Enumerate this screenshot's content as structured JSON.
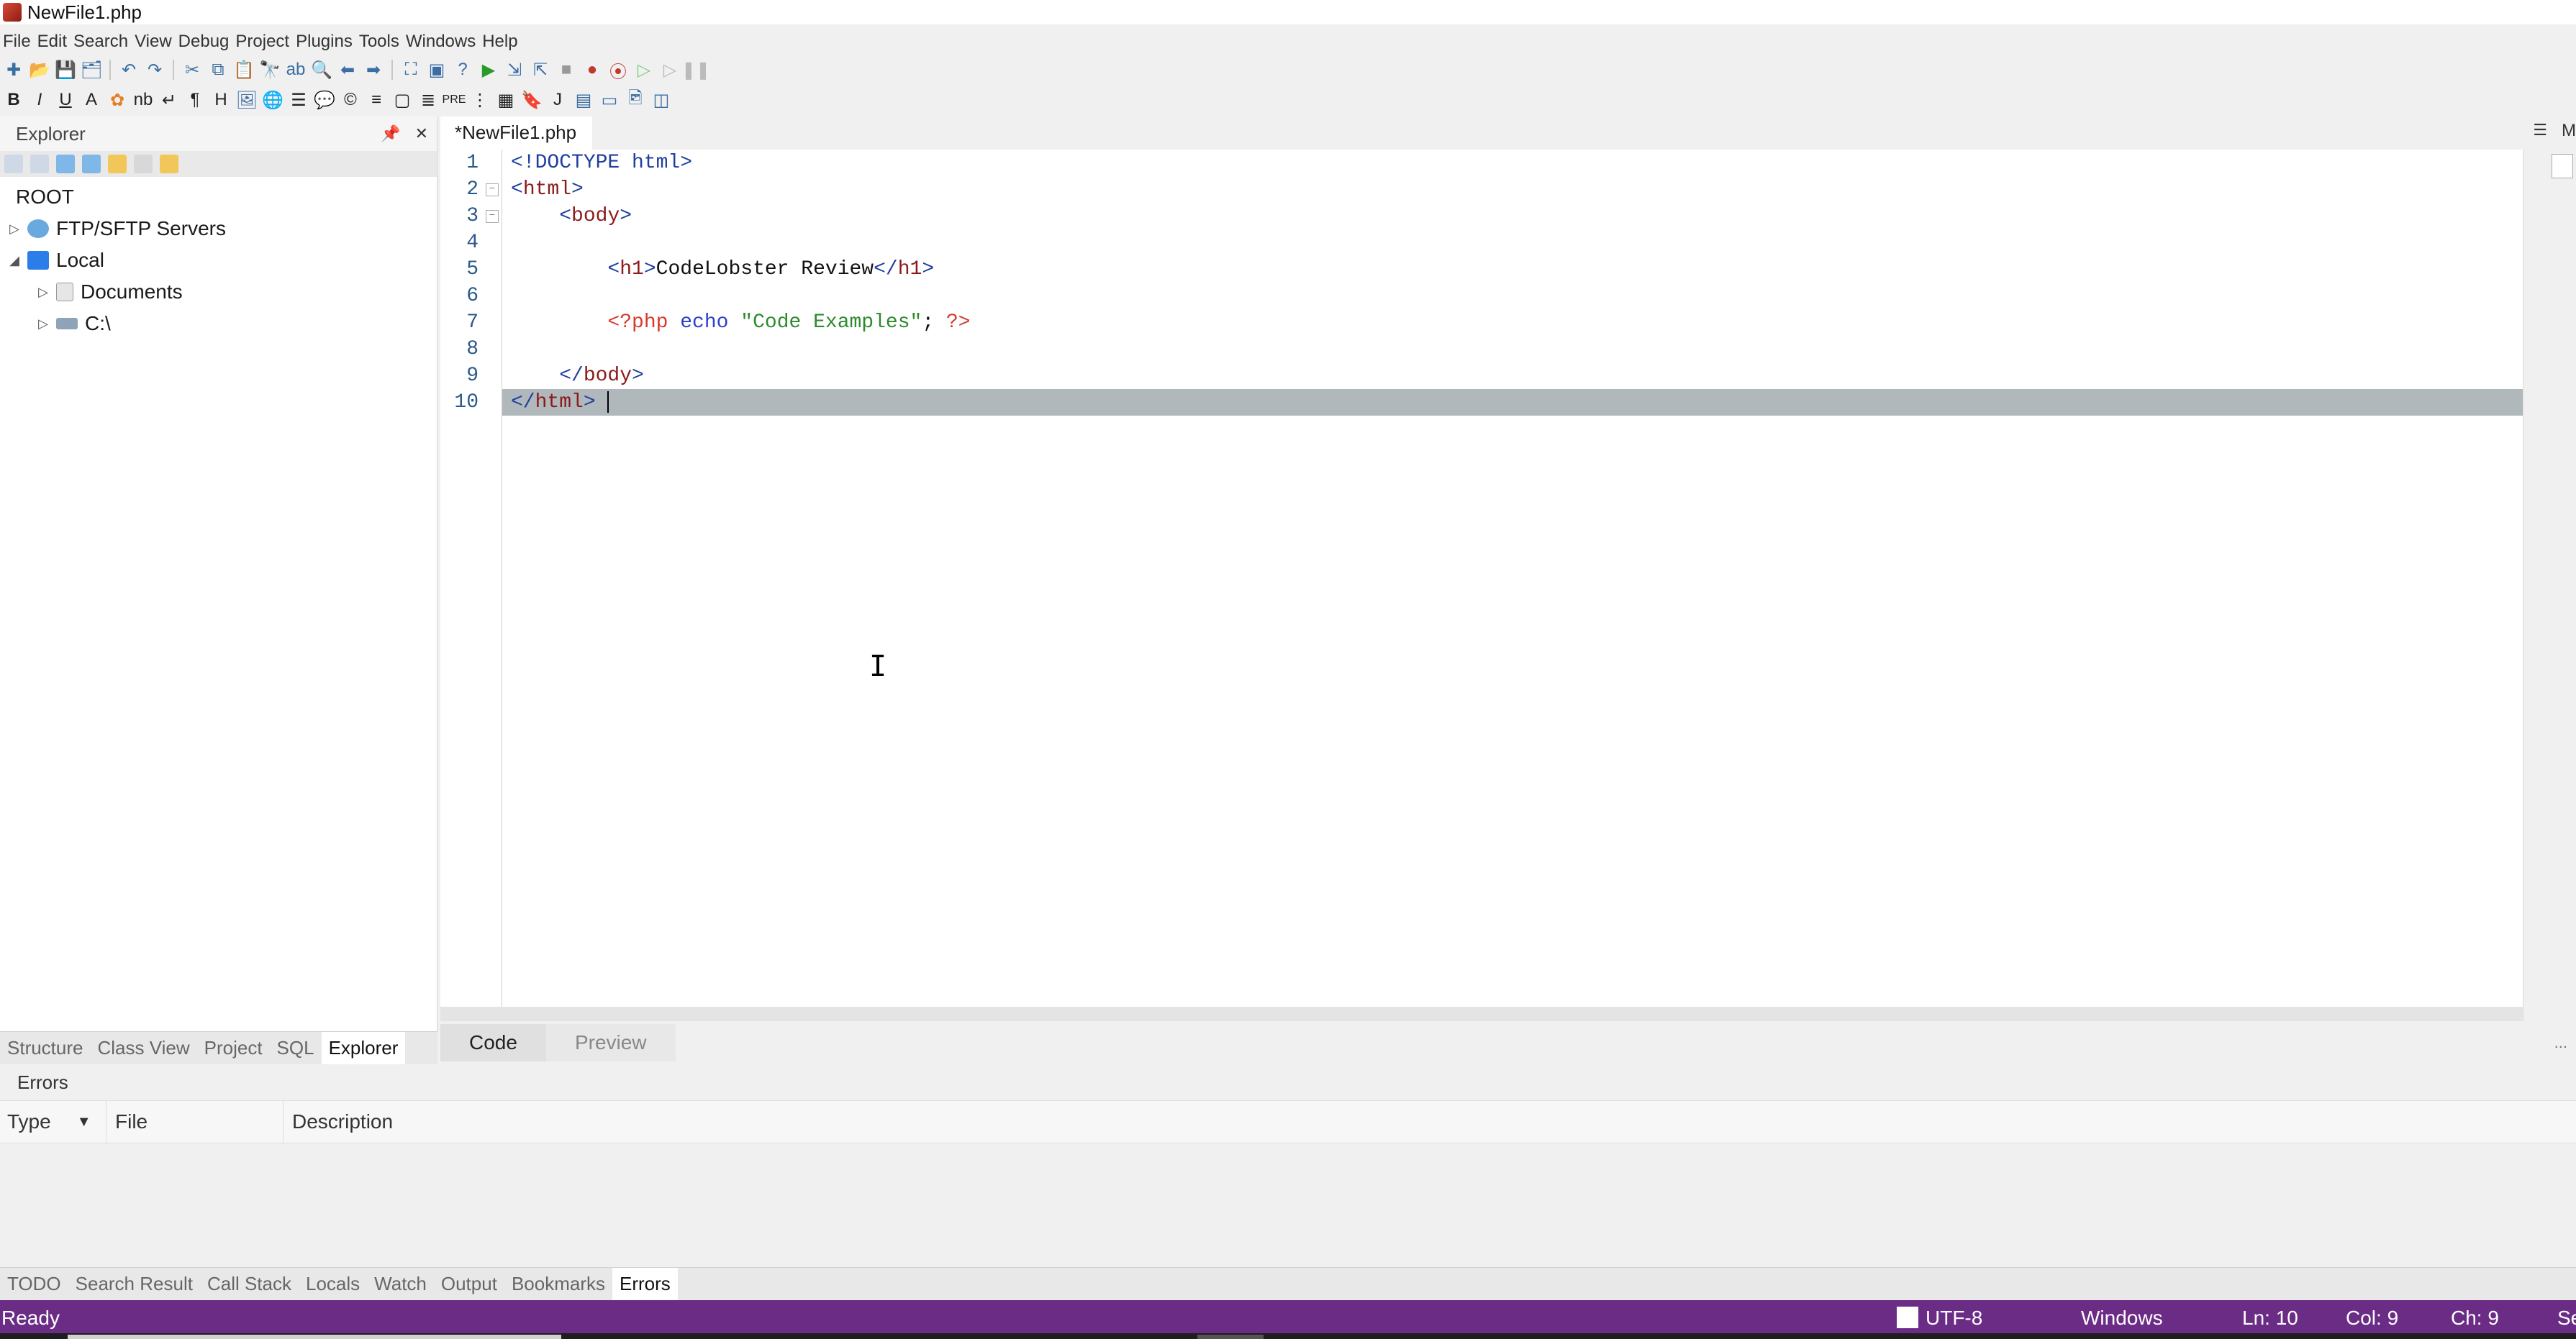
{
  "window": {
    "title": "NewFile1.php"
  },
  "menu": [
    "File",
    "Edit",
    "Search",
    "View",
    "Debug",
    "Project",
    "Plugins",
    "Tools",
    "Windows",
    "Help"
  ],
  "explorer": {
    "title": "Explorer",
    "root_label": "ROOT",
    "tree": [
      {
        "label": "FTP/SFTP Servers",
        "expanded": false,
        "icon": "globe-icon"
      },
      {
        "label": "Local",
        "expanded": true,
        "icon": "computer-icon"
      },
      {
        "label": "Documents",
        "expanded": false,
        "icon": "document-icon"
      },
      {
        "label": "C:\\",
        "expanded": false,
        "icon": "drive-icon"
      }
    ],
    "tabs": [
      "Structure",
      "Class View",
      "Project",
      "SQL",
      "Explorer"
    ],
    "active_tab": "Explorer"
  },
  "editor": {
    "tab_label": "*NewFile1.php",
    "side_label": "M",
    "line_numbers": [
      "1",
      "2",
      "3",
      "4",
      "5",
      "6",
      "7",
      "8",
      "9",
      "10"
    ],
    "lines": {
      "l1": {
        "tag_open": "<!DOCTYPE html>"
      },
      "l2": {
        "tag_lt": "<",
        "tag": "html",
        "tag_gt": ">"
      },
      "l3": {
        "indent": "    ",
        "tag_lt": "<",
        "tag": "body",
        "tag_gt": ">"
      },
      "l5": {
        "indent": "        ",
        "open_lt": "<",
        "open_tag": "h1",
        "open_gt": ">",
        "text": "CodeLobster Review",
        "close_lt": "</",
        "close_tag": "h1",
        "close_gt": ">"
      },
      "l7": {
        "indent": "        ",
        "php_open": "<?php",
        "kw": "echo",
        "str": "\"Code Examples\"",
        "semi": ";",
        "php_close": "?>"
      },
      "l9": {
        "indent": "    ",
        "tag_lt": "</",
        "tag": "body",
        "tag_gt": ">"
      },
      "l10": {
        "tag_lt": "</",
        "tag": "html",
        "tag_gt": ">"
      }
    },
    "view_tabs": [
      "Code",
      "Preview"
    ],
    "active_view": "Code",
    "more": "..."
  },
  "errors": {
    "title": "Errors",
    "columns": [
      "Type",
      "File",
      "Description"
    ],
    "rows": []
  },
  "bottom_tabs": [
    "TODO",
    "Search Result",
    "Call Stack",
    "Locals",
    "Watch",
    "Output",
    "Bookmarks",
    "Errors"
  ],
  "active_bottom_tab": "Errors",
  "status": {
    "state": "Ready",
    "encoding": "UTF-8",
    "line_ending": "Windows",
    "line": "Ln: 10",
    "col": "Col: 9",
    "ch": "Ch: 9",
    "extra": "Se"
  },
  "colors": {
    "status_bar": "#6b2c85",
    "current_line": "#b0b8bb",
    "tag": "#1f3f9f",
    "tag_name": "#8b1a1a",
    "php": "#d63a2a",
    "keyword": "#2b3fcf",
    "string": "#2d8a2d"
  }
}
